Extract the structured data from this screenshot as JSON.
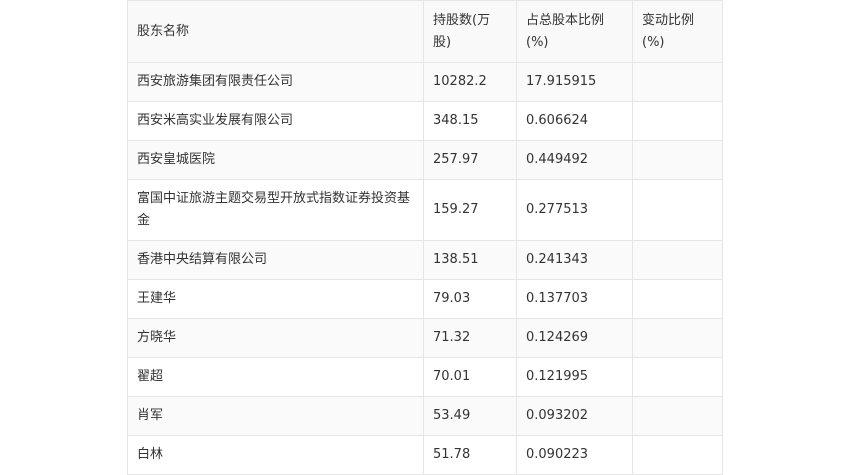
{
  "table": {
    "headers": [
      "股东名称",
      "持股数(万股)",
      "占总股本比例(%)",
      "变动比例(%)"
    ],
    "rows": [
      [
        "西安旅游集团有限责任公司",
        "10282.2",
        "17.915915",
        ""
      ],
      [
        "西安米高实业发展有限公司",
        "348.15",
        "0.606624",
        ""
      ],
      [
        "西安皇城医院",
        "257.97",
        "0.449492",
        ""
      ],
      [
        "富国中证旅游主题交易型开放式指数证券投资基金",
        "159.27",
        "0.277513",
        ""
      ],
      [
        "香港中央结算有限公司",
        "138.51",
        "0.241343",
        ""
      ],
      [
        "王建华",
        "79.03",
        "0.137703",
        ""
      ],
      [
        "方晓华",
        "71.32",
        "0.124269",
        ""
      ],
      [
        "翟超",
        "70.01",
        "0.121995",
        ""
      ],
      [
        "肖军",
        "53.49",
        "0.093202",
        ""
      ],
      [
        "白林",
        "51.78",
        "0.090223",
        ""
      ]
    ]
  }
}
